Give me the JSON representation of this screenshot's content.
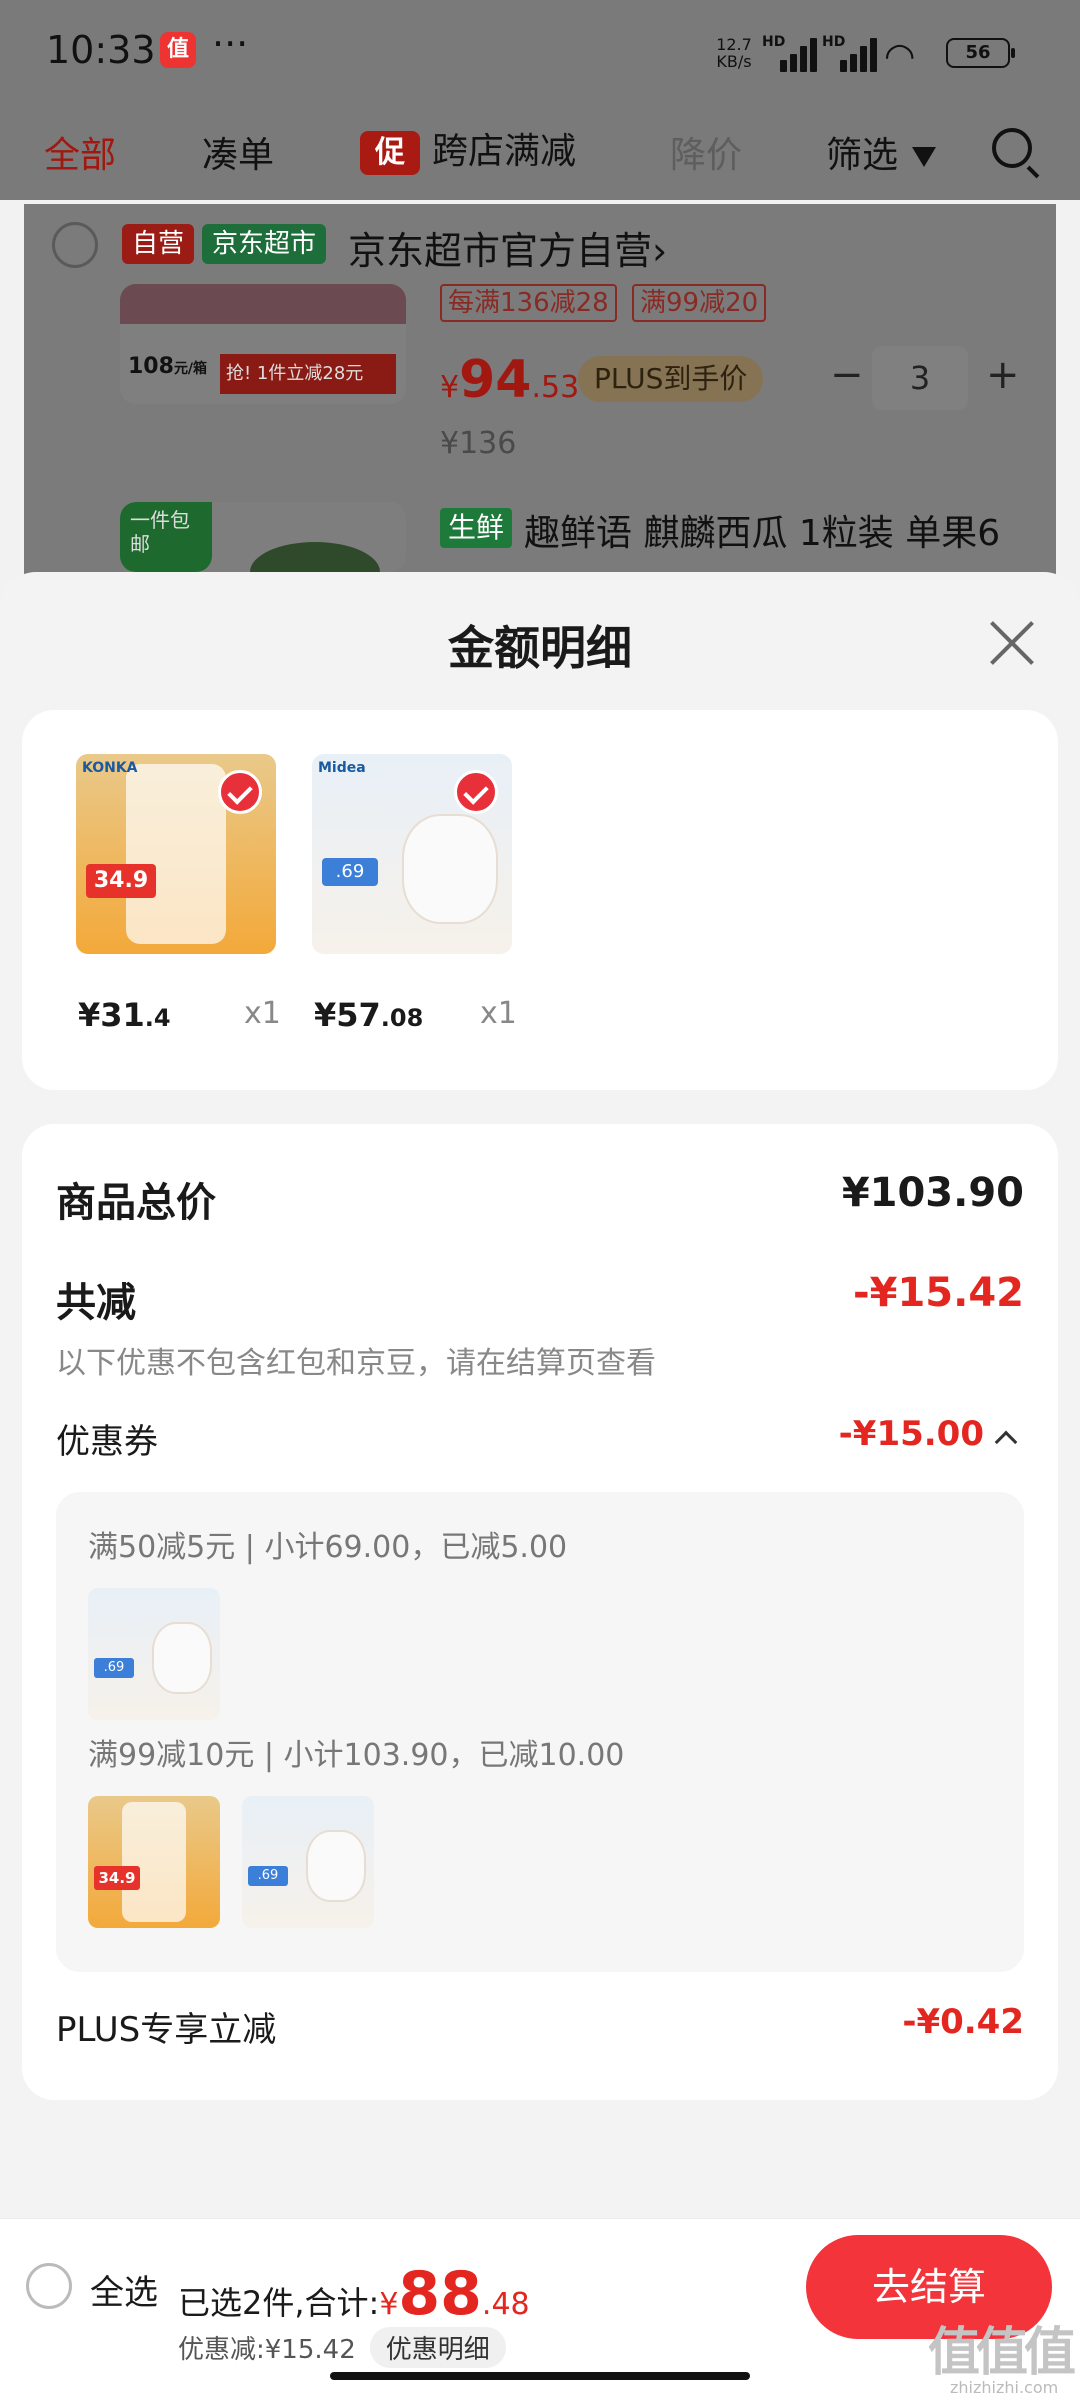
{
  "status_bar": {
    "time": "10:33",
    "app_icon": "值",
    "dots": "···",
    "net_speed_top": "12.7",
    "net_speed_bottom": "KB/s",
    "hd1": "HD",
    "hd2": "HD",
    "battery": "56",
    "icons": [
      "signal-icon",
      "wifi-icon",
      "battery-icon"
    ]
  },
  "tabs": [
    {
      "label": "全部",
      "state": "active"
    },
    {
      "label": "凑单",
      "state": "normal"
    },
    {
      "label": "跨店满减",
      "badge": "促",
      "state": "normal"
    },
    {
      "label": "降价",
      "state": "dim"
    },
    {
      "label": "筛选",
      "state": "normal"
    }
  ],
  "store": {
    "self_tag": "自营",
    "market_tag": "京东超市",
    "name": "京东超市官方自营",
    "chevron": "›",
    "promo_tags": [
      "每满136减28",
      "满99减20"
    ],
    "img_price_text": "108",
    "img_price_unit": "元/箱",
    "img_banner": "抢! 1件立减28元",
    "price_sym": "¥",
    "price_int": "94",
    "price_dec": ".53",
    "plus_label": "PLUS到手价",
    "qty": "3",
    "minus": "−",
    "plus": "+",
    "old_price": "¥136",
    "next_img_badge": "一件包邮",
    "next_tag": "生鲜",
    "next_title": "趣鲜语 麒麟西瓜 1粒装 单果6"
  },
  "sheet": {
    "title": "金额明细",
    "items": [
      {
        "sym": "¥",
        "int": "31",
        "dec": ".4",
        "qty": "x1",
        "img_brand": "KONKA",
        "img_price": "34.9"
      },
      {
        "sym": "¥",
        "int": "57",
        "dec": ".08",
        "qty": "x1",
        "img_brand": "Midea",
        "img_price": ".69"
      }
    ],
    "total_label": "商品总价",
    "total_value": "¥103.90",
    "discount_label": "共减",
    "discount_value": "-¥15.42",
    "discount_note": "以下优惠不包含红包和京豆，请在结算页查看",
    "coupon_label": "优惠券",
    "coupon_value": "-¥15.00",
    "coupons": [
      {
        "text": "满50减5元 | 小计69.00，已减5.00"
      },
      {
        "text": "满99减10元 | 小计103.90，已减10.00"
      }
    ],
    "plus_label": "PLUS专享立减",
    "plus_value": "-¥0.42"
  },
  "bottom": {
    "select_all": "全选",
    "selected_text": "已选2件,合计:",
    "sum_sym": "¥",
    "sum_int": "88",
    "sum_dec": ".48",
    "discount_text": "优惠减:¥15.42",
    "detail_btn": "优惠明细",
    "checkout": "去结算"
  },
  "watermark": {
    "text": "值值值",
    "sub": "zhizhizhi.com"
  },
  "colors": {
    "accent": "#e3261f",
    "checkout": "#f3343a",
    "dim_overlay": "#7a7a7a"
  }
}
